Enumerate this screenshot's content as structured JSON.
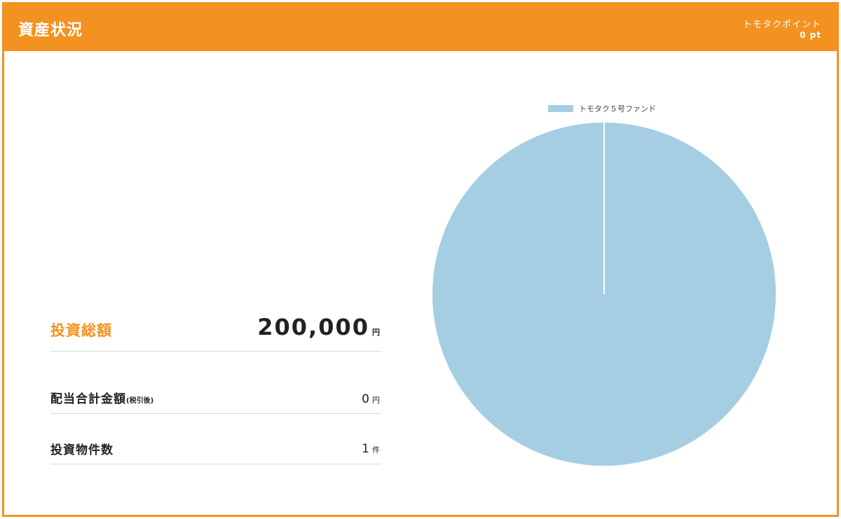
{
  "header": {
    "title": "資産状況",
    "points_label": "トモタクポイント",
    "points_value": "0 pt"
  },
  "summary": {
    "total_label": "投資総額",
    "total_value": "200,000",
    "total_unit": "円",
    "dividend_label": "配当合計金額",
    "dividend_note": "(税引後)",
    "dividend_value": "0",
    "dividend_unit": "円",
    "count_label": "投資物件数",
    "count_value": "1",
    "count_unit": "件"
  },
  "colors": {
    "accent": "#f39220",
    "pie": "#a6cee2"
  },
  "chart_data": {
    "type": "pie",
    "labels": [
      "トモタク５号ファンド"
    ],
    "values": [
      200000
    ],
    "colors": [
      "#a6cee2"
    ],
    "legend_position": "top"
  }
}
